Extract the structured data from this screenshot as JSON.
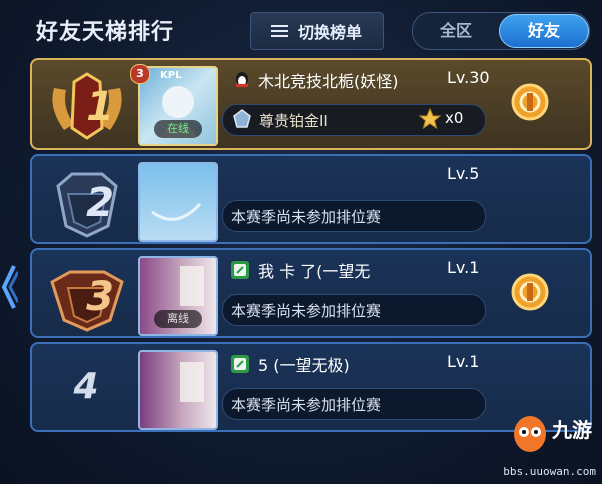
{
  "header": {
    "title": "好友天梯排行",
    "switch_label": "切换榜单",
    "tabs": [
      {
        "label": "全区",
        "selected": false
      },
      {
        "label": "好友",
        "selected": true
      }
    ]
  },
  "rows": [
    {
      "rank": "1",
      "level_badge": "3",
      "avatar_tag": "KPL",
      "status": "在线",
      "name": "木北竞技北栀(妖怪)",
      "level": "Lv.30",
      "tier": "尊贵铂金II",
      "stars": "x0",
      "has_gift": true
    },
    {
      "rank": "2",
      "name": "",
      "level": "Lv.5",
      "info": "本赛季尚未参加排位赛",
      "has_gift": false
    },
    {
      "rank": "3",
      "status": "离线",
      "name": "我    卡 了(一望无",
      "level": "Lv.1",
      "info": "本赛季尚未参加排位赛",
      "has_gift": true
    },
    {
      "rank": "4",
      "name": "5    (一望无极)",
      "level": "Lv.1",
      "info": "本赛季尚未参加排位赛",
      "has_gift": false
    }
  ],
  "watermark": {
    "brand": "九游",
    "url": "bbs.uuowan.com"
  },
  "colors": {
    "gold_border": "#d9b45a",
    "blue_border": "#3d6fb8",
    "tab_active": "#2a86e0",
    "online": "#6ef07c"
  }
}
